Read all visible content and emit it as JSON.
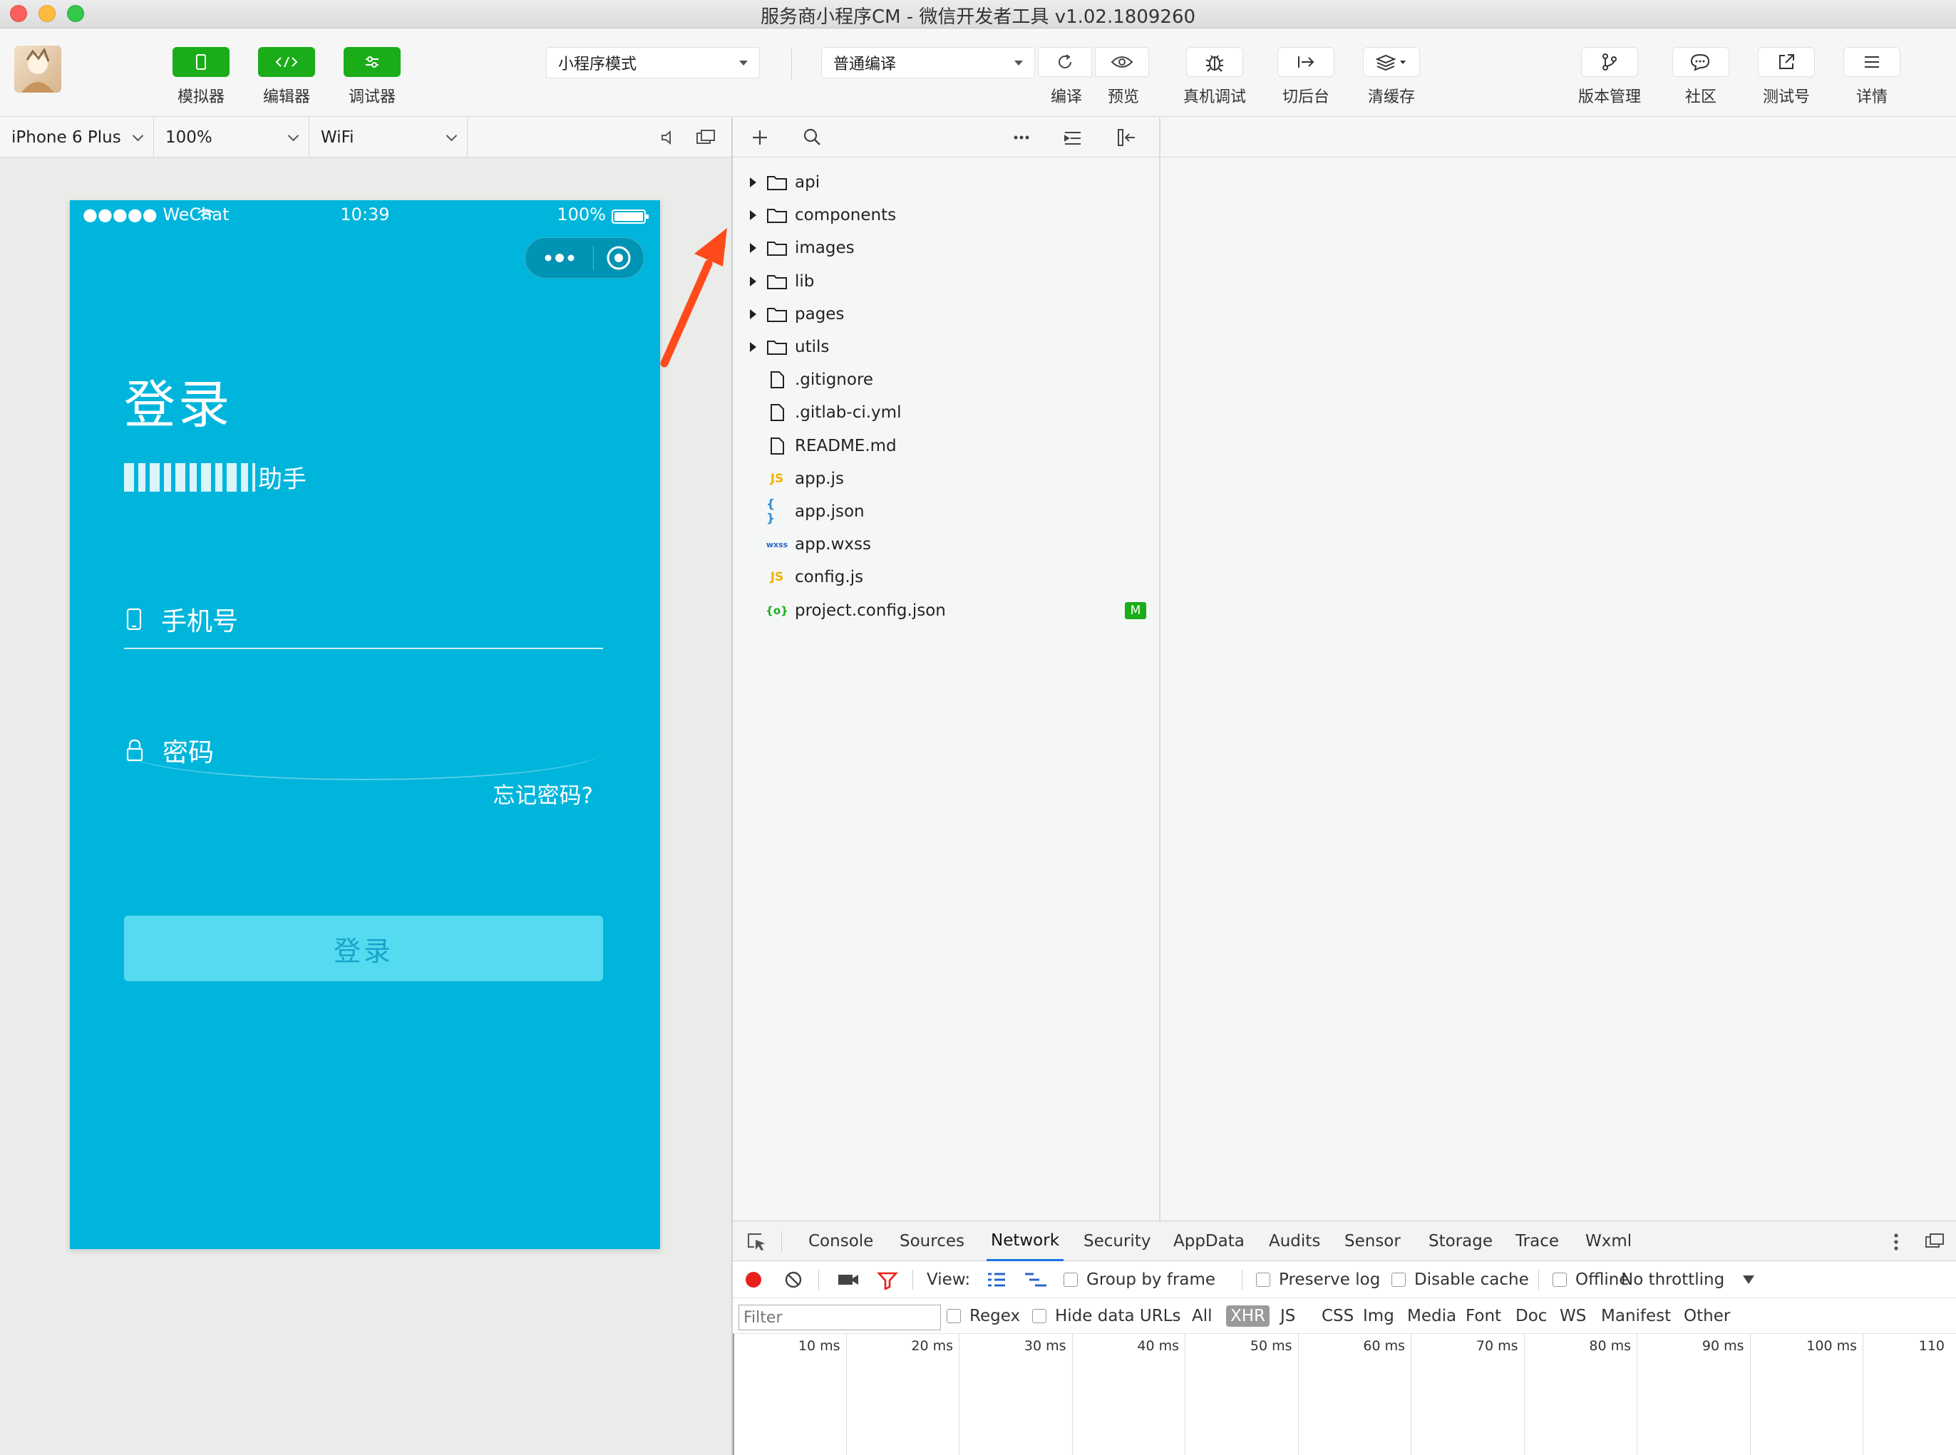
{
  "window": {
    "title": "服务商小程序CM - 微信开发者工具 v1.02.1809260"
  },
  "toolbar": {
    "left": [
      {
        "label": "模拟器",
        "icon": "phone-icon"
      },
      {
        "label": "编辑器",
        "icon": "code-icon"
      },
      {
        "label": "调试器",
        "icon": "sliders-icon"
      }
    ],
    "mode_select": "小程序模式",
    "compile_select": "普通编译",
    "actions": [
      {
        "label": "编译",
        "icon": "refresh-icon"
      },
      {
        "label": "预览",
        "icon": "eye-icon"
      },
      {
        "label": "真机调试",
        "icon": "bug-icon"
      },
      {
        "label": "切后台",
        "icon": "switch-icon"
      },
      {
        "label": "清缓存",
        "icon": "layers-icon"
      }
    ],
    "right": [
      {
        "label": "版本管理",
        "icon": "branch-icon"
      },
      {
        "label": "社区",
        "icon": "chat-icon"
      },
      {
        "label": "测试号",
        "icon": "external-icon"
      },
      {
        "label": "详情",
        "icon": "menu-icon"
      }
    ]
  },
  "device_bar": {
    "device": "iPhone 6 Plus",
    "zoom": "100%",
    "network": "WiFi"
  },
  "phone": {
    "carrier": "●●●●● WeChat",
    "time": "10:39",
    "battery": "100%",
    "title": "登录",
    "subtitle_suffix": "助手",
    "phone_placeholder": "手机号",
    "password_placeholder": "密码",
    "forgot": "忘记密码?",
    "login_button": "登录"
  },
  "files": [
    {
      "name": "api",
      "type": "folder"
    },
    {
      "name": "components",
      "type": "folder"
    },
    {
      "name": "images",
      "type": "folder"
    },
    {
      "name": "lib",
      "type": "folder"
    },
    {
      "name": "pages",
      "type": "folder"
    },
    {
      "name": "utils",
      "type": "folder"
    },
    {
      "name": ".gitignore",
      "type": "file"
    },
    {
      "name": ".gitlab-ci.yml",
      "type": "file"
    },
    {
      "name": "README.md",
      "type": "file"
    },
    {
      "name": "app.js",
      "type": "js",
      "icon_text": "JS"
    },
    {
      "name": "app.json",
      "type": "json",
      "icon_text": "{ }"
    },
    {
      "name": "app.wxss",
      "type": "wxss",
      "icon_text": "wxss"
    },
    {
      "name": "config.js",
      "type": "js",
      "icon_text": "JS"
    },
    {
      "name": "project.config.json",
      "type": "config",
      "icon_text": "{o}",
      "badge": "M"
    }
  ],
  "devtools": {
    "tabs": [
      "Console",
      "Sources",
      "Network",
      "Security",
      "AppData",
      "Audits",
      "Sensor",
      "Storage",
      "Trace",
      "Wxml"
    ],
    "active_tab": "Network",
    "controls": {
      "view_label": "View:",
      "group_by_frame": "Group by frame",
      "preserve_log": "Preserve log",
      "disable_cache": "Disable cache",
      "offline": "Offline",
      "throttling": "No throttling"
    },
    "filter": {
      "placeholder": "Filter",
      "regex": "Regex",
      "hide_data_urls": "Hide data URLs",
      "types": [
        "All",
        "XHR",
        "JS",
        "CSS",
        "Img",
        "Media",
        "Font",
        "Doc",
        "WS",
        "Manifest",
        "Other"
      ],
      "active_type": "XHR"
    },
    "timeline_ticks": [
      "10 ms",
      "20 ms",
      "30 ms",
      "40 ms",
      "50 ms",
      "60 ms",
      "70 ms",
      "80 ms",
      "90 ms",
      "100 ms",
      "110"
    ]
  },
  "colors": {
    "brand_green": "#1aad19",
    "phone_bg": "#00b5dc",
    "login_button": "#55dbef",
    "annotation_arrow": "#ff4a1c"
  }
}
